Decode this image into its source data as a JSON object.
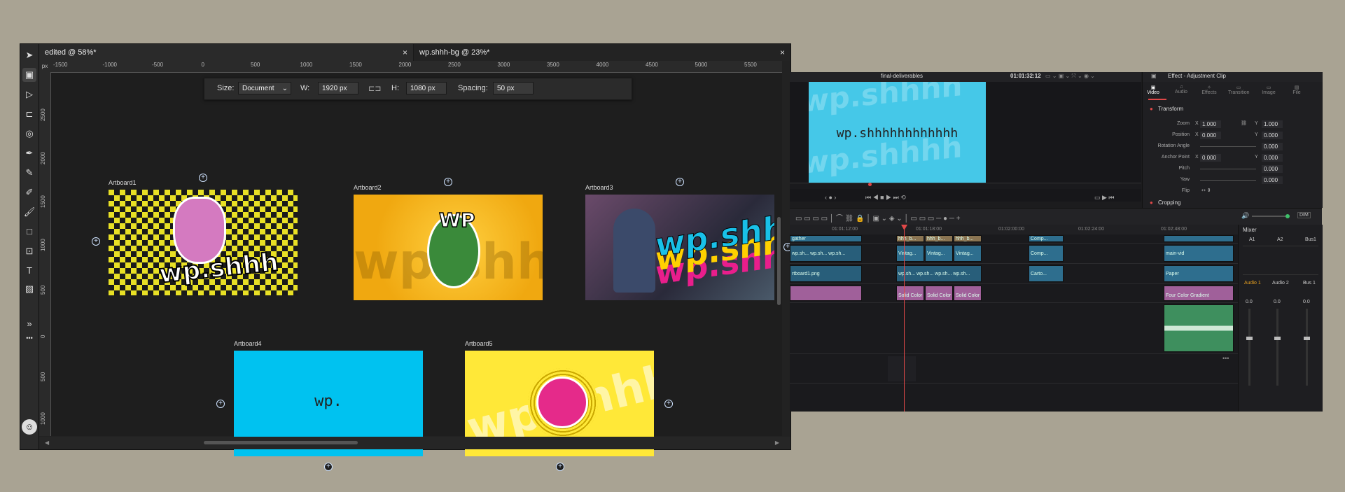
{
  "design": {
    "tabs": [
      {
        "label": "edited @ 58%*"
      },
      {
        "label": "wp.shhh-bg @ 23%*"
      }
    ],
    "close_glyph": "×",
    "ruler_unit": "px",
    "ruler_ticks": [
      "-1500",
      "-1000",
      "-500",
      "0",
      "500",
      "1000",
      "1500",
      "2000",
      "2500",
      "3000",
      "3500",
      "4000",
      "4500",
      "5000",
      "5500"
    ],
    "ruler_left_ticks": [
      "2500",
      "2000",
      "1500",
      "1000",
      "500",
      "0",
      "500",
      "1000"
    ],
    "context_bar": {
      "size_label": "Size:",
      "size_value": "Document",
      "w_label": "W:",
      "w_value": "1920 px",
      "h_label": "H:",
      "h_value": "1080 px",
      "spacing_label": "Spacing:",
      "spacing_value": "50 px"
    },
    "artboards": [
      {
        "label": "Artboard1",
        "text": "wp.shhh",
        "bg": "#e8e025"
      },
      {
        "label": "Artboard2",
        "text": "WP",
        "bg": "#f4b21a"
      },
      {
        "label": "Artboard3",
        "text": "wp.shhh",
        "bg": "#5a4a5e"
      },
      {
        "label": "Artboard4",
        "text": "wp.",
        "bg": "#00c2f0"
      },
      {
        "label": "Artboard5",
        "text": "wp.shhh",
        "bg": "#ffe838"
      }
    ],
    "tools": [
      "select-icon",
      "artboard-icon",
      "node-icon",
      "crop-icon",
      "fill-icon",
      "pen-icon",
      "pencil-icon",
      "vector-brush-icon",
      "brush-icon",
      "rectangle-icon",
      "frame-text-icon",
      "art-text-icon",
      "image-icon"
    ],
    "more": "»",
    "dots": "•••"
  },
  "resolve": {
    "timeline_name": "final-deliverables",
    "timecode": "01:01:32:12",
    "inspector_title": "Effect - Adjustment Clip",
    "viewer_text": "wp.shhhhhhhhhhhh",
    "inspector_tabs": [
      "Video",
      "Audio",
      "Effects",
      "Transition",
      "Image",
      "File"
    ],
    "transform_label": "Transform",
    "cropping_label": "Cropping",
    "rows": [
      {
        "label": "Zoom",
        "x": "1.000",
        "y": "1.000"
      },
      {
        "label": "Position",
        "x": "0.000",
        "y": "0.000"
      },
      {
        "label": "Rotation Angle",
        "x": "",
        "y": "0.000"
      },
      {
        "label": "Anchor Point",
        "x": "0.000",
        "y": "0.000"
      },
      {
        "label": "Pitch",
        "x": "",
        "y": "0.000"
      },
      {
        "label": "Yaw",
        "x": "",
        "y": "0.000"
      },
      {
        "label": "Flip",
        "x": "",
        "y": ""
      }
    ],
    "ruler_times": [
      "01:01:12:00",
      "01:01:18:00",
      "01:02:00:00",
      "01:02:24:00",
      "01:02:48:00"
    ],
    "clips": {
      "track4": [
        "gather",
        "hhh_b...",
        "hhh_b...",
        "hhh_b...",
        "Comp..."
      ],
      "track3": [
        "wp.sh...",
        "wp.sh...",
        "wp.sh...",
        "Vintag...",
        "Vintag...",
        "Vintag...",
        "Comp...",
        "main-vid"
      ],
      "track2": [
        "rtboard1.png",
        "wp.sh...",
        "wp.sh...",
        "wp.sh...",
        "wp.sh...",
        "Carto...",
        "Paper"
      ],
      "track1": [
        "Solid Color",
        "Solid Color",
        "Solid Color",
        "Four Color Gradient"
      ]
    },
    "mixer": {
      "title": "Mixer",
      "channels": [
        "A1",
        "A2",
        "Bus1"
      ],
      "names": [
        "Audio 1",
        "Audio 2",
        "Bus 1"
      ],
      "dim": "DIM",
      "level": "0.0"
    }
  }
}
